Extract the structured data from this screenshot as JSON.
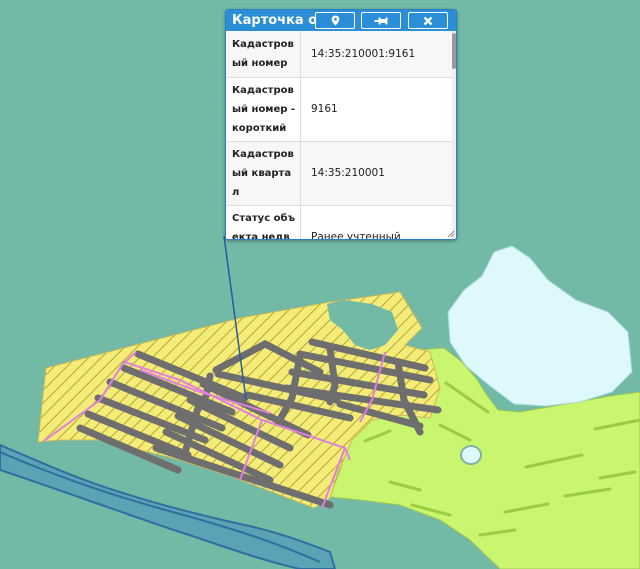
{
  "popup": {
    "title": "Карточка объекта",
    "buttons": [
      {
        "icon": "map-marker-icon"
      },
      {
        "icon": "pin-icon"
      },
      {
        "icon": "close-icon"
      }
    ],
    "rows": [
      {
        "label": "Кадастровый номер",
        "value": "14:35:210001:9161"
      },
      {
        "label": "Кадастровый номер - короткий",
        "value": "9161"
      },
      {
        "label": "Кадастровый квартал",
        "value": "14:35:210001"
      },
      {
        "label": "Статус объекта недвижимо",
        "value": "Ранее учтенный"
      }
    ]
  },
  "colors": {
    "water": "#72b9a6",
    "parcel_fill": "#f4ec79",
    "parcel_hatch": "#b8a531",
    "building": "#6e6e6e",
    "land_green": "#c9f56f",
    "lake": "#dff8fb",
    "boundary_line": "#e07fe0",
    "river": "#3b7fae",
    "header_blue": "#2a8fd6"
  }
}
